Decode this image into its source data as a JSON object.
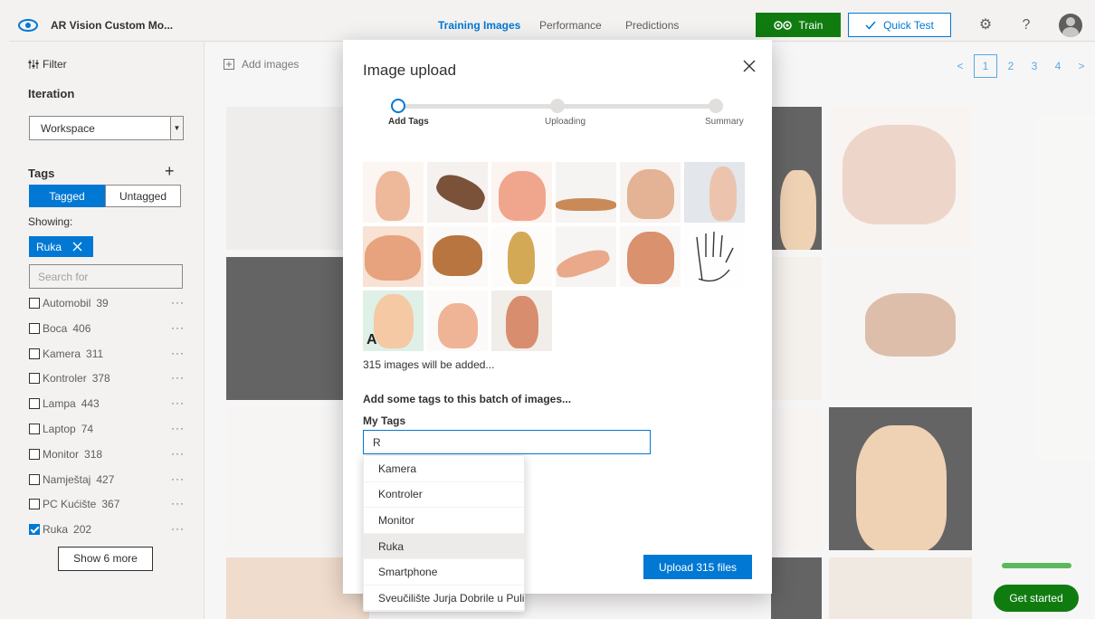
{
  "app": {
    "title": "AR Vision Custom Mo..."
  },
  "nav": {
    "tabs": [
      {
        "label": "Training Images",
        "active": true
      },
      {
        "label": "Performance",
        "active": false
      },
      {
        "label": "Predictions",
        "active": false
      }
    ],
    "train_label": "Train",
    "quick_test_label": "Quick Test"
  },
  "sidebar": {
    "filter_label": "Filter",
    "iteration_label": "Iteration",
    "iteration_value": "Workspace",
    "tags_label": "Tags",
    "tagged_label": "Tagged",
    "untagged_label": "Untagged",
    "showing_label": "Showing:",
    "active_chip": "Ruka",
    "search_placeholder": "Search for",
    "tags": [
      {
        "name": "Automobil",
        "count": "39",
        "checked": false
      },
      {
        "name": "Boca",
        "count": "406",
        "checked": false
      },
      {
        "name": "Kamera",
        "count": "311",
        "checked": false
      },
      {
        "name": "Kontroler",
        "count": "378",
        "checked": false
      },
      {
        "name": "Lampa",
        "count": "443",
        "checked": false
      },
      {
        "name": "Laptop",
        "count": "74",
        "checked": false
      },
      {
        "name": "Monitor",
        "count": "318",
        "checked": false
      },
      {
        "name": "Namještaj",
        "count": "427",
        "checked": false
      },
      {
        "name": "PC Kućište",
        "count": "367",
        "checked": false
      },
      {
        "name": "Ruka",
        "count": "202",
        "checked": true
      }
    ],
    "show_more_label": "Show 6 more"
  },
  "toolbar": {
    "add_images_label": "Add images"
  },
  "pager": {
    "pages": [
      "1",
      "2",
      "3",
      "4"
    ],
    "current": "1",
    "prev": "<",
    "next": ">"
  },
  "modal": {
    "title": "Image upload",
    "steps": [
      {
        "label": "Add Tags",
        "active": true
      },
      {
        "label": "Uploading",
        "active": false
      },
      {
        "label": "Summary",
        "active": false
      }
    ],
    "images_added_text": "315 images will be added...",
    "add_tags_hint": "Add some tags to this batch of images...",
    "my_tags_label": "My Tags",
    "tag_input_value": "R",
    "upload_label": "Upload 315 files"
  },
  "dropdown": {
    "options": [
      {
        "label": "Kamera",
        "selected": false
      },
      {
        "label": "Kontroler",
        "selected": false
      },
      {
        "label": "Monitor",
        "selected": false
      },
      {
        "label": "Ruka",
        "selected": true
      },
      {
        "label": "Smartphone",
        "selected": false
      },
      {
        "label": "Sveučilište Jurja Dobrile u Puli",
        "selected": false
      }
    ]
  },
  "get_started_label": "Get started",
  "colors": {
    "accent": "#0078d4",
    "train_green": "#107c10",
    "progress_green": "#5cb85c"
  },
  "icons": [
    "eye-icon",
    "filter-icon",
    "add-images-icon",
    "plus-icon",
    "close-icon",
    "gear-icon",
    "help-icon",
    "train-icon",
    "check-icon",
    "chevron-down-icon"
  ]
}
